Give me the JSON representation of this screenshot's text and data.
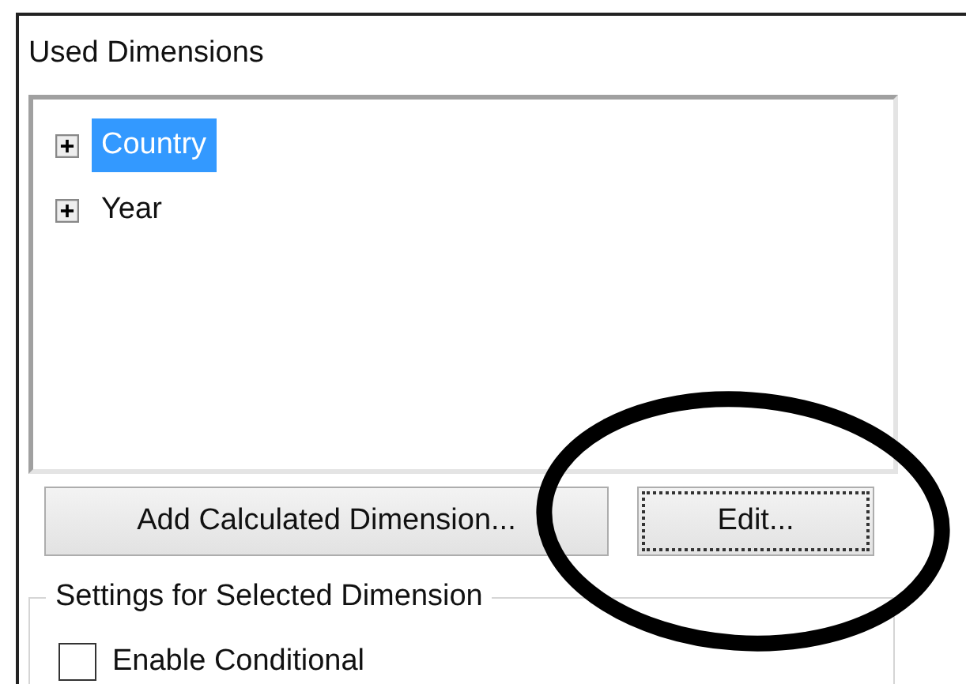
{
  "used_dimensions": {
    "label": "Used Dimensions",
    "items": [
      {
        "label": "Country",
        "selected": true,
        "expanded": false
      },
      {
        "label": "Year",
        "selected": false,
        "expanded": false
      }
    ]
  },
  "buttons": [
    {
      "label": "Add Calculated Dimension...",
      "focused": false
    },
    {
      "label": "Edit...",
      "focused": true
    }
  ],
  "settings_group": {
    "title": "Settings for Selected Dimension",
    "options": [
      {
        "label": "Enable Conditional",
        "checked": false
      }
    ]
  }
}
